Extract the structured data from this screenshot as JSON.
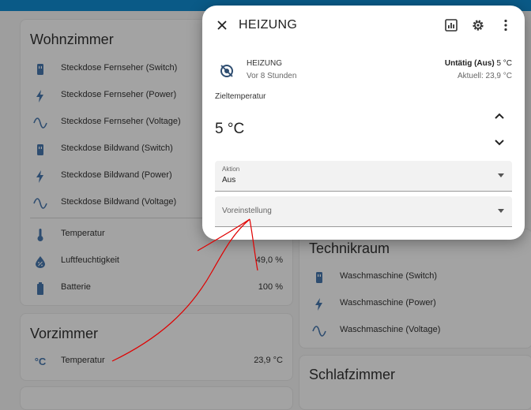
{
  "wohnzimmer": {
    "title": "Wohnzimmer",
    "rows": [
      {
        "icon": "power-socket-icon",
        "label": "Steckdose Fernseher (Switch)",
        "value": ""
      },
      {
        "icon": "flash-icon",
        "label": "Steckdose Fernseher (Power)",
        "value": ""
      },
      {
        "icon": "sine-wave-icon",
        "label": "Steckdose Fernseher (Voltage)",
        "value": ""
      },
      {
        "icon": "power-socket-icon",
        "label": "Steckdose Bildwand (Switch)",
        "value": ""
      },
      {
        "icon": "flash-icon",
        "label": "Steckdose Bildwand (Power)",
        "value": ""
      },
      {
        "icon": "sine-wave-icon",
        "label": "Steckdose Bildwand (Voltage)",
        "value": ""
      },
      {
        "icon": "thermometer-icon",
        "label": "Temperatur",
        "value": ""
      },
      {
        "icon": "water-percent-icon",
        "label": "Luftfeuchtigkeit",
        "value": "49,0 %"
      },
      {
        "icon": "battery-icon",
        "label": "Batterie",
        "value": "100 %"
      }
    ]
  },
  "vorzimmer": {
    "title": "Vorzimmer",
    "rows": [
      {
        "icon": "temperature-celsius-icon",
        "icon_glyph": "°C",
        "label": "Temperatur",
        "value": "23,9 °C"
      }
    ]
  },
  "technikraum": {
    "title": "Technikraum",
    "rows": [
      {
        "icon": "power-socket-icon",
        "label": "Waschmaschine (Switch)"
      },
      {
        "icon": "flash-icon",
        "label": "Waschmaschine (Power)"
      },
      {
        "icon": "sine-wave-icon",
        "label": "Waschmaschine (Voltage)"
      }
    ]
  },
  "schlafzimmer": {
    "title": "Schlafzimmer"
  },
  "dialog": {
    "title": "HEIZUNG",
    "entity_name": "HEIZUNG",
    "last_changed": "Vor 8 Stunden",
    "state_bold": "Untätig (Aus)",
    "state_target": "5 °C",
    "current": "Aktuell: 23,9 °C",
    "target_label": "Zieltemperatur",
    "target_value": "5 °C",
    "action_label": "Aktion",
    "action_value": "Aus",
    "preset_label": "Voreinstellung"
  },
  "colors": {
    "topbar": "#0a5a87",
    "icon": "#2e4d70",
    "annotation": "#e00000"
  }
}
